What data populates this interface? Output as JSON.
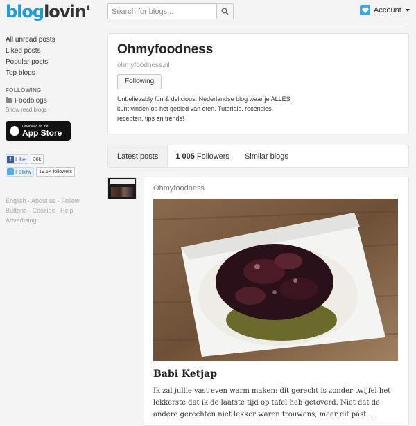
{
  "header": {
    "logo_blog": "blog",
    "logo_lovin": "lovin'",
    "search_placeholder": "Search for blogs...",
    "account_label": "Account"
  },
  "sidebar": {
    "nav": [
      "All unread posts",
      "Liked posts",
      "Popular posts",
      "Top blogs"
    ],
    "following_heading": "FOLLOWING",
    "folder": "Foodblogs",
    "show_read": "Show read blogs",
    "appstore_small": "Download on the",
    "appstore_big": "App Store",
    "facebook": {
      "label": "Like",
      "count": "36k"
    },
    "twitter": {
      "label": "Follow",
      "count": "19.6K followers"
    },
    "footer": "English · About us · Follow Buttons · Cookies · Help · Advertising"
  },
  "blog": {
    "title": "Ohmyfoodness",
    "url": "ohmyfoodness.nl",
    "follow_label": "Following",
    "description": "Unbelievably fun & delicious. Nederlandse blog waar je ALLES kunt vinden op het gebied van eten. Tutorials. recensies. recepten. tips en trends!"
  },
  "tabs": {
    "latest": "Latest posts",
    "followers_count": "1 005",
    "followers_label": "Followers",
    "similar": "Similar blogs"
  },
  "post": {
    "source": "Ohmyfoodness",
    "title": "Babi Ketjap",
    "excerpt": "Ik zal jullie vast even warm maken: dit gerecht is zonder twijfel het lekkerste dat ik de laatste tijd op tafel heb getoverd. Niet dat de andere gerechten niet lekker waren trouwens, maar dit past ..."
  },
  "colors": {
    "brand": "#1e9bd7",
    "facebook": "#3b5998",
    "twitter": "#55acee"
  }
}
